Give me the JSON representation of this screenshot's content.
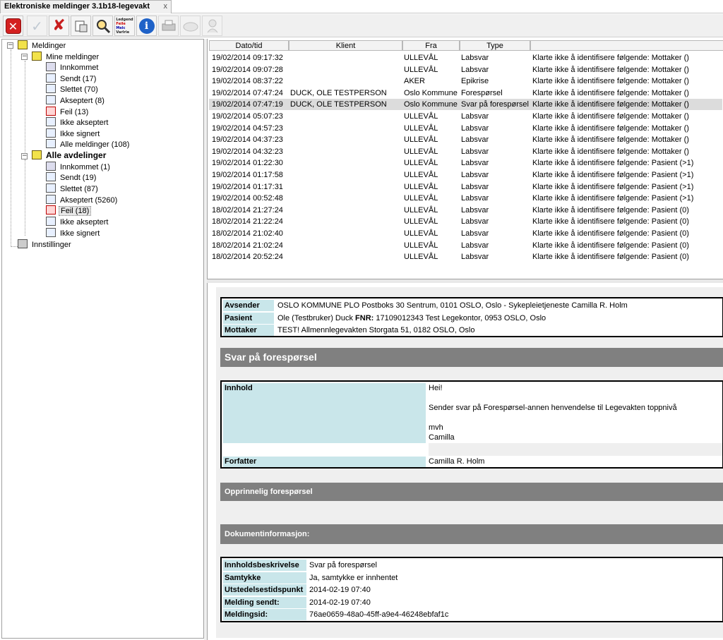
{
  "tab": {
    "title": "Elektroniske meldinger 3.1b18-legevakt",
    "close": "x"
  },
  "toolbar": {
    "legend_lines": [
      "Ledgend",
      "Feile",
      "Melc",
      "Varlrie"
    ],
    "buttons": [
      "close-app",
      "approve",
      "reject",
      "save",
      "search",
      "legend",
      "info",
      "print",
      "sign",
      "user"
    ]
  },
  "tree": {
    "root": "Meldinger",
    "mine": "Mine meldinger",
    "mine_items": [
      "Innkommet",
      "Sendt (17)",
      "Slettet (70)",
      "Akseptert (8)",
      "Feil (13)",
      "Ikke akseptert",
      "Ikke signert",
      "Alle meldinger (108)"
    ],
    "all": "Alle avdelinger",
    "all_items": [
      "Innkommet (1)",
      "Sendt (19)",
      "Slettet (87)",
      "Akseptert (5260)",
      "Feil (18)",
      "Ikke akseptert",
      "Ikke signert"
    ],
    "settings": "Innstillinger",
    "expander_minus": "−"
  },
  "list": {
    "columns": [
      "Dato/tid",
      "Klient",
      "Fra",
      "Type",
      ""
    ],
    "rows": [
      [
        "19/02/2014 09:17:32",
        "",
        "ULLEVÅL",
        "Labsvar",
        "Klarte ikke å identifisere følgende: Mottaker ()"
      ],
      [
        "19/02/2014 09:07:28",
        "",
        "ULLEVÅL",
        "Labsvar",
        "Klarte ikke å identifisere følgende: Mottaker ()"
      ],
      [
        "19/02/2014 08:37:22",
        "",
        "AKER",
        "Epikrise",
        "Klarte ikke å identifisere følgende: Mottaker ()"
      ],
      [
        "19/02/2014 07:47:24",
        "DUCK, OLE TESTPERSON",
        "Oslo Kommune",
        "Forespørsel",
        "Klarte ikke å identifisere følgende: Mottaker ()"
      ],
      [
        "19/02/2014 07:47:19",
        "DUCK, OLE TESTPERSON",
        "Oslo Kommune",
        "Svar på forespørsel",
        "Klarte ikke å identifisere følgende: Mottaker ()"
      ],
      [
        "19/02/2014 05:07:23",
        "",
        "ULLEVÅL",
        "Labsvar",
        "Klarte ikke å identifisere følgende: Mottaker ()"
      ],
      [
        "19/02/2014 04:57:23",
        "",
        "ULLEVÅL",
        "Labsvar",
        "Klarte ikke å identifisere følgende: Mottaker ()"
      ],
      [
        "19/02/2014 04:37:23",
        "",
        "ULLEVÅL",
        "Labsvar",
        "Klarte ikke å identifisere følgende: Mottaker ()"
      ],
      [
        "19/02/2014 04:32:23",
        "",
        "ULLEVÅL",
        "Labsvar",
        "Klarte ikke å identifisere følgende: Mottaker ()"
      ],
      [
        "19/02/2014 01:22:30",
        "",
        "ULLEVÅL",
        "Labsvar",
        "Klarte ikke å identifisere følgende: Pasient (>1)"
      ],
      [
        "19/02/2014 01:17:58",
        "",
        "ULLEVÅL",
        "Labsvar",
        "Klarte ikke å identifisere følgende: Pasient (>1)"
      ],
      [
        "19/02/2014 01:17:31",
        "",
        "ULLEVÅL",
        "Labsvar",
        "Klarte ikke å identifisere følgende: Pasient (>1)"
      ],
      [
        "19/02/2014 00:52:48",
        "",
        "ULLEVÅL",
        "Labsvar",
        "Klarte ikke å identifisere følgende: Pasient (>1)"
      ],
      [
        "18/02/2014 21:27:24",
        "",
        "ULLEVÅL",
        "Labsvar",
        "Klarte ikke å identifisere følgende: Pasient (0)"
      ],
      [
        "18/02/2014 21:22:24",
        "",
        "ULLEVÅL",
        "Labsvar",
        "Klarte ikke å identifisere følgende: Pasient (0)"
      ],
      [
        "18/02/2014 21:02:40",
        "",
        "ULLEVÅL",
        "Labsvar",
        "Klarte ikke å identifisere følgende: Pasient (0)"
      ],
      [
        "18/02/2014 21:02:24",
        "",
        "ULLEVÅL",
        "Labsvar",
        "Klarte ikke å identifisere følgende: Pasient (0)"
      ],
      [
        "18/02/2014 20:52:24",
        "",
        "ULLEVÅL",
        "Labsvar",
        "Klarte ikke å identifisere følgende: Pasient (0)"
      ]
    ]
  },
  "detail": {
    "header": {
      "avsender_label": "Avsender",
      "avsender_value": "OSLO KOMMUNE PLO  Postboks 30 Sentrum, 0101 OSLO, Oslo  - Sykepleietjeneste    Camilla R.  Holm",
      "pasient_label": "Pasient",
      "pasient_name": "Ole (Testbruker)  Duck",
      "fnr_label": "FNR:",
      "fnr_value": "17109012343  Test Legekontor, 0953 OSLO, Oslo",
      "mottaker_label": "Mottaker",
      "mottaker_value": "TEST! Allmennlegevakten  Storgata 51, 0182 OSLO, Oslo"
    },
    "section_title": "Svar på forespørsel",
    "innhold_label": "Innhold",
    "innhold_lines": [
      "Hei!",
      "",
      "Sender svar på Forespørsel-annen henvendelse til Legevakten toppnivå",
      "",
      "mvh",
      "Camilla"
    ],
    "forfatter_label": "Forfatter",
    "forfatter_value": "Camilla R.  Holm",
    "opprinnelig_title": "Opprinnelig forespørsel",
    "dokinfo_title": "Dokumentinformasjon:",
    "dokinfo": [
      {
        "label": "Innholdsbeskrivelse",
        "value": "Svar på forespørsel"
      },
      {
        "label": "Samtykke",
        "value": "Ja, samtykke er innhentet"
      },
      {
        "label": "Utstedelsestidspunkt",
        "value": "2014-02-19 07:40"
      },
      {
        "label": "Melding sendt:",
        "value": "2014-02-19 07:40"
      },
      {
        "label": "Meldingsid:",
        "value": "76ae0659-48a0-45ff-a9e4-46248ebfaf1c"
      }
    ]
  }
}
